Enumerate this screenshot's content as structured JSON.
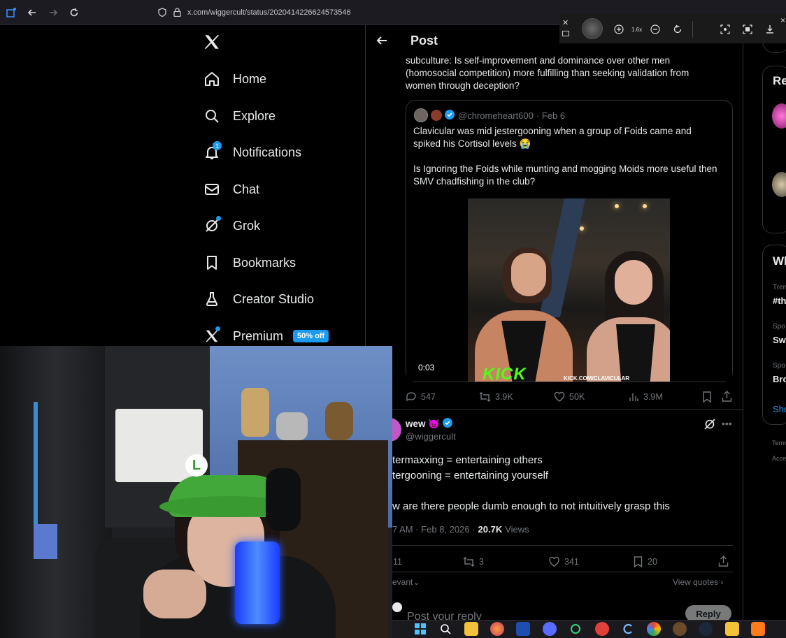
{
  "browser": {
    "url": "x.com/wiggercult/status/2020414226624573546"
  },
  "viewer_toolbar": {
    "zoom_level": "1.6x"
  },
  "nav": {
    "items": [
      {
        "label": "Home",
        "icon": "home-icon"
      },
      {
        "label": "Explore",
        "icon": "search-icon"
      },
      {
        "label": "Notifications",
        "icon": "bell-icon",
        "badge": "1"
      },
      {
        "label": "Chat",
        "icon": "mail-icon"
      },
      {
        "label": "Grok",
        "icon": "grok-icon"
      },
      {
        "label": "Bookmarks",
        "icon": "bookmark-icon"
      },
      {
        "label": "Creator Studio",
        "icon": "flask-icon"
      },
      {
        "label": "Premium",
        "icon": "x-icon",
        "badge": "50% off"
      }
    ]
  },
  "post": {
    "header_title": "Post",
    "body_text": "subculture: Is self-improvement and dominance over other men (homosocial competition) more fulfilling than seeking validation from women through deception?",
    "quote": {
      "handle": "@chromeheart600",
      "date": "· Feb 6",
      "text1": "Clavicular was mid jestergooning when a group of Foids came and spiked his Cortisol levels 😭",
      "text2": "Is Ignoring the Foids while munting and mogging Moids more useful then SMV chadfishing in the club?",
      "video_time": "0:03",
      "kick_logo": "KICK",
      "kick_url": "KICK.COM/CLAVICULAR"
    },
    "quote_stats": {
      "replies": "547",
      "reposts": "3.9K",
      "likes": "50K",
      "views": "3.9M"
    }
  },
  "reply": {
    "name": "wew 😈",
    "handle": "@wiggercult",
    "line1": "termaxxing = entertaining others",
    "line2": "tergooning = entertaining yourself",
    "line3": "w are there people dumb enough to not intuitively grasp this",
    "meta_time": "7 AM · Feb 8, 2026 ·",
    "meta_views_count": "20.7K",
    "meta_views_label": "Views",
    "stats": {
      "replies": "11",
      "reposts": "3",
      "likes": "341",
      "bookmarks": "20"
    },
    "sort_label": "evant",
    "view_quotes": "View quotes",
    "reply_placeholder": "Post your reply",
    "reply_button": "Reply"
  },
  "right_col": {
    "search_fragment": "",
    "box1_title": "Re",
    "box2_title": "Wh",
    "trend1_meta": "Tren",
    "trend1_title": "#th",
    "trend2_meta": "Spo",
    "trend2_title": "Sw",
    "trend3_meta": "Spo",
    "trend3_title": "Bro",
    "show_more": "Sho",
    "footer1": "Term",
    "footer2": "Acce"
  },
  "colors": {
    "accent": "#1d9bf0",
    "background": "#000000",
    "border": "#2f3336",
    "muted": "#71767b",
    "kick_green": "#53fc18"
  }
}
